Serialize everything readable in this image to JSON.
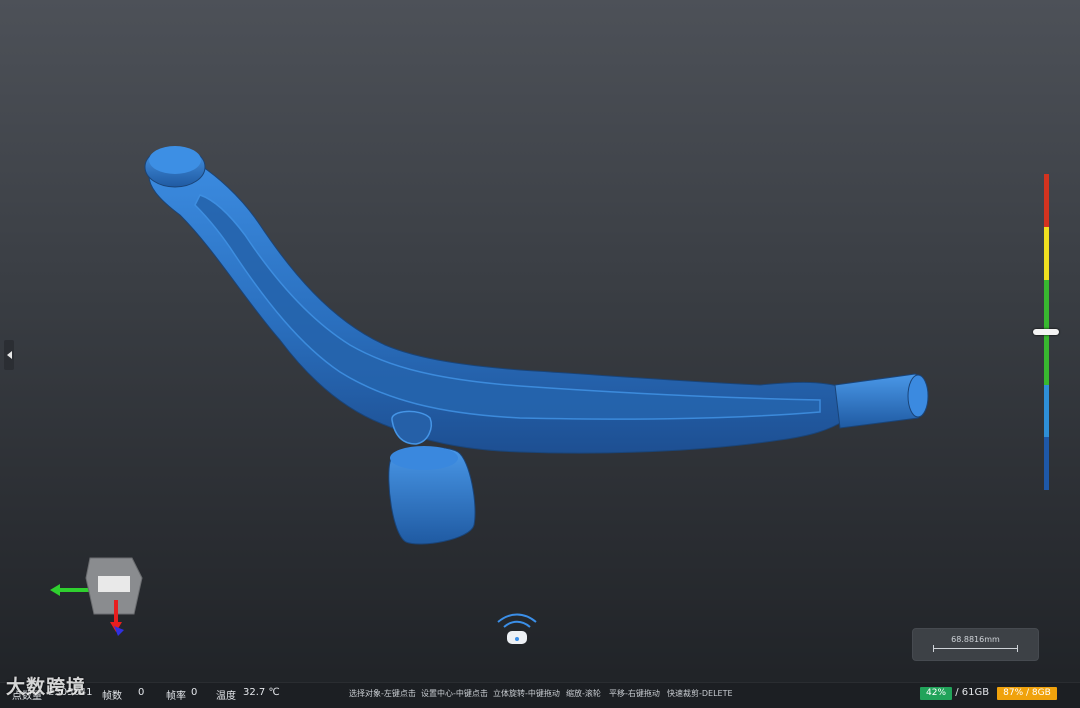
{
  "status": {
    "points_label": "点数量",
    "points_value": "2305641",
    "frames_label": "帧数",
    "frames_value": "0",
    "fps_label": "帧率",
    "fps_value": "0",
    "temp_label": "温度",
    "temp_value": "32.7 ℃",
    "hints": [
      "选择对象-左键点击",
      "设置中心-中键点击",
      "立体旋转-中键拖动",
      "缩放-滚轮",
      "平移-右键拖动",
      "快速裁剪-DELETE"
    ],
    "disk_percent": "42%",
    "disk_total": "/ 61GB",
    "mem_text": "87% / 8GB"
  },
  "scale": {
    "label": "68.8816mm"
  },
  "watermark": "大数跨境",
  "colors": {
    "model": "#2f77c4",
    "disk_badge": "#21a35a",
    "mem_badge": "#f0a20c",
    "bar": [
      "#d3331f",
      "#f0e020",
      "#38b82f",
      "#2e8fd8",
      "#1e58a8"
    ]
  }
}
